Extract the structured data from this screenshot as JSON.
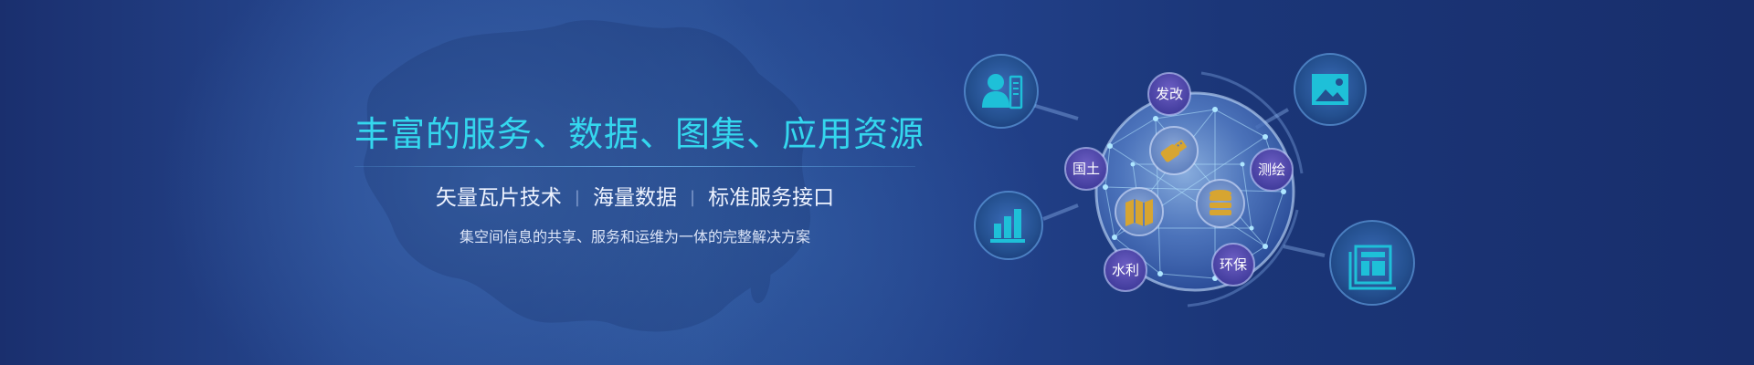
{
  "headline": {
    "title": "丰富的服务、数据、图集、应用资源",
    "features": [
      "矢量瓦片技术",
      "海量数据",
      "标准服务接口"
    ],
    "separator": "|",
    "tagline": "集空间信息的共享、服务和运维为一体的完整解决方案"
  },
  "globe": {
    "labels": {
      "top": "发改",
      "left": "国土",
      "right": "测绘",
      "bottom_left": "水利",
      "bottom_right": "环保"
    },
    "inner_icons": [
      "usb-key-icon",
      "map-icon",
      "database-icon"
    ]
  },
  "satellite_icons": [
    "user-document-icon",
    "bar-chart-icon",
    "image-icon",
    "newspaper-icon"
  ],
  "colors": {
    "title": "#34d7ee",
    "accent": "#1ec0d8",
    "gold": "#d7a531",
    "background": "#22418a"
  }
}
